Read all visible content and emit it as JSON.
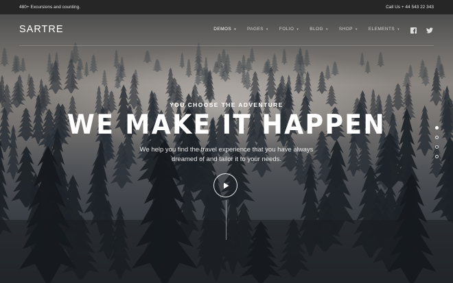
{
  "topbar": {
    "left_text": "480+ Excursions and counting.",
    "right_text": "Call Us + 44 543 22 343"
  },
  "header": {
    "logo": "SARTRE",
    "nav": [
      {
        "label": "DEMOS",
        "active": true
      },
      {
        "label": "PAGES",
        "active": false
      },
      {
        "label": "FOLIO",
        "active": false
      },
      {
        "label": "BLOG",
        "active": false
      },
      {
        "label": "SHOP",
        "active": false
      },
      {
        "label": "ELEMENTS",
        "active": false
      }
    ],
    "social": [
      "facebook-icon",
      "twitter-icon"
    ]
  },
  "hero": {
    "kicker": "YOU CHOOSE THE ADVENTURE",
    "headline": "WE MAKE IT HAPPEN",
    "subtext": "We help you find the travel experience that you have always dreamed of and tailor it to your needs.",
    "play_icon": "play-icon",
    "slides": {
      "count": 4,
      "active_index": 0
    }
  },
  "colors": {
    "topbar_bg": "#262626",
    "text": "#ffffff"
  }
}
